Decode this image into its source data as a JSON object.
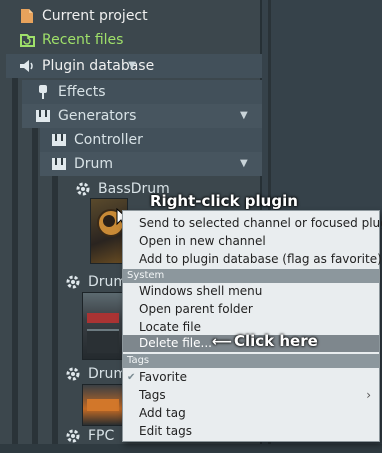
{
  "browser": {
    "items": [
      {
        "label": "Current project",
        "icon": "document-icon",
        "color": "#f0f0f0"
      },
      {
        "label": "Recent files",
        "icon": "recent-files-icon",
        "color": "#9fe06a"
      },
      {
        "label": "Plugin database",
        "icon": "speaker-icon",
        "color": "#f0f0f0"
      },
      {
        "label": "Effects",
        "icon": "plug-icon",
        "color": "#e8eef0"
      },
      {
        "label": "Generators",
        "icon": "piano-icon",
        "color": "#e8eef0"
      },
      {
        "label": "Controller",
        "icon": "piano-icon",
        "color": "#e8eef0"
      },
      {
        "label": "Drum",
        "icon": "piano-icon",
        "color": "#e8eef0"
      },
      {
        "label": "BassDrum",
        "icon": "gear-icon",
        "color": "#e8eef0"
      },
      {
        "label": "Drumaxx",
        "icon": "gear-icon",
        "color": "#e8eef0"
      },
      {
        "label": "Drumpad",
        "icon": "gear-icon",
        "color": "#e8eef0"
      },
      {
        "label": "FPC",
        "icon": "gear-icon",
        "color": "#e8eef0"
      }
    ]
  },
  "annotations": {
    "right_click": "Right-click plugin",
    "click_here": "Click here",
    "arrow": "⟵"
  },
  "menu": {
    "items_a": [
      "Send to selected channel or focused plugin",
      "Open in new channel",
      "Add to plugin database (flag as favorite)"
    ],
    "system_label": "System",
    "items_b": [
      "Windows shell menu",
      "Open parent folder",
      "Locate file",
      "Delete file..."
    ],
    "tags_label": "Tags",
    "items_c": [
      "Favorite",
      "Tags",
      "Add tag",
      "Edit tags"
    ]
  },
  "colors": {
    "accent_green": "#9fe06a",
    "menu_highlight": "#7e878d"
  }
}
